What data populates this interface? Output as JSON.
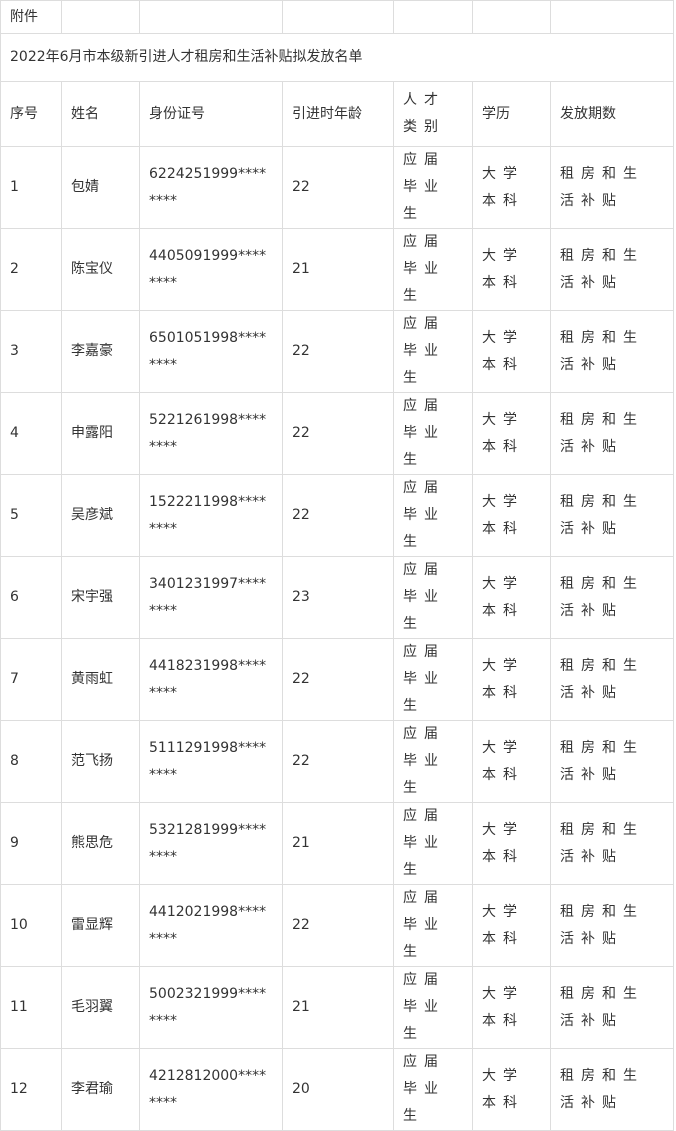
{
  "attachment_label": "附件",
  "title": "2022年6月市本级新引进人才租房和生活补贴拟发放名单",
  "headers": {
    "no": "序号",
    "name": "姓名",
    "id": "身份证号",
    "age": "引进时年龄",
    "category": "人才类别",
    "education": "学历",
    "period": "发放期数"
  },
  "rows": [
    {
      "no": "1",
      "name": "包婧",
      "id": "6224251999********",
      "age": "22",
      "category": "应届毕业生",
      "education": "大学本科",
      "period": "租房和生活补贴"
    },
    {
      "no": "2",
      "name": "陈宝仪",
      "id": "4405091999********",
      "age": "21",
      "category": "应届毕业生",
      "education": "大学本科",
      "period": "租房和生活补贴"
    },
    {
      "no": "3",
      "name": "李嘉豪",
      "id": "6501051998********",
      "age": "22",
      "category": "应届毕业生",
      "education": "大学本科",
      "period": "租房和生活补贴"
    },
    {
      "no": "4",
      "name": "申露阳",
      "id": "5221261998********",
      "age": "22",
      "category": "应届毕业生",
      "education": "大学本科",
      "period": "租房和生活补贴"
    },
    {
      "no": "5",
      "name": "吴彦斌",
      "id": "1522211998********",
      "age": "22",
      "category": "应届毕业生",
      "education": "大学本科",
      "period": "租房和生活补贴"
    },
    {
      "no": "6",
      "name": "宋宇强",
      "id": "3401231997********",
      "age": "23",
      "category": "应届毕业生",
      "education": "大学本科",
      "period": "租房和生活补贴"
    },
    {
      "no": "7",
      "name": "黄雨虹",
      "id": "4418231998********",
      "age": "22",
      "category": "应届毕业生",
      "education": "大学本科",
      "period": "租房和生活补贴"
    },
    {
      "no": "8",
      "name": "范飞扬",
      "id": "5111291998********",
      "age": "22",
      "category": "应届毕业生",
      "education": "大学本科",
      "period": "租房和生活补贴"
    },
    {
      "no": "9",
      "name": "熊思危",
      "id": "5321281999********",
      "age": "21",
      "category": "应届毕业生",
      "education": "大学本科",
      "period": "租房和生活补贴"
    },
    {
      "no": "10",
      "name": "雷显辉",
      "id": "4412021998********",
      "age": "22",
      "category": "应届毕业生",
      "education": "大学本科",
      "period": "租房和生活补贴"
    },
    {
      "no": "11",
      "name": "毛羽翼",
      "id": "5002321999********",
      "age": "21",
      "category": "应届毕业生",
      "education": "大学本科",
      "period": "租房和生活补贴"
    },
    {
      "no": "12",
      "name": "李君瑜",
      "id": "4212812000********",
      "age": "20",
      "category": "应届毕业生",
      "education": "大学本科",
      "period": "租房和生活补贴"
    }
  ]
}
